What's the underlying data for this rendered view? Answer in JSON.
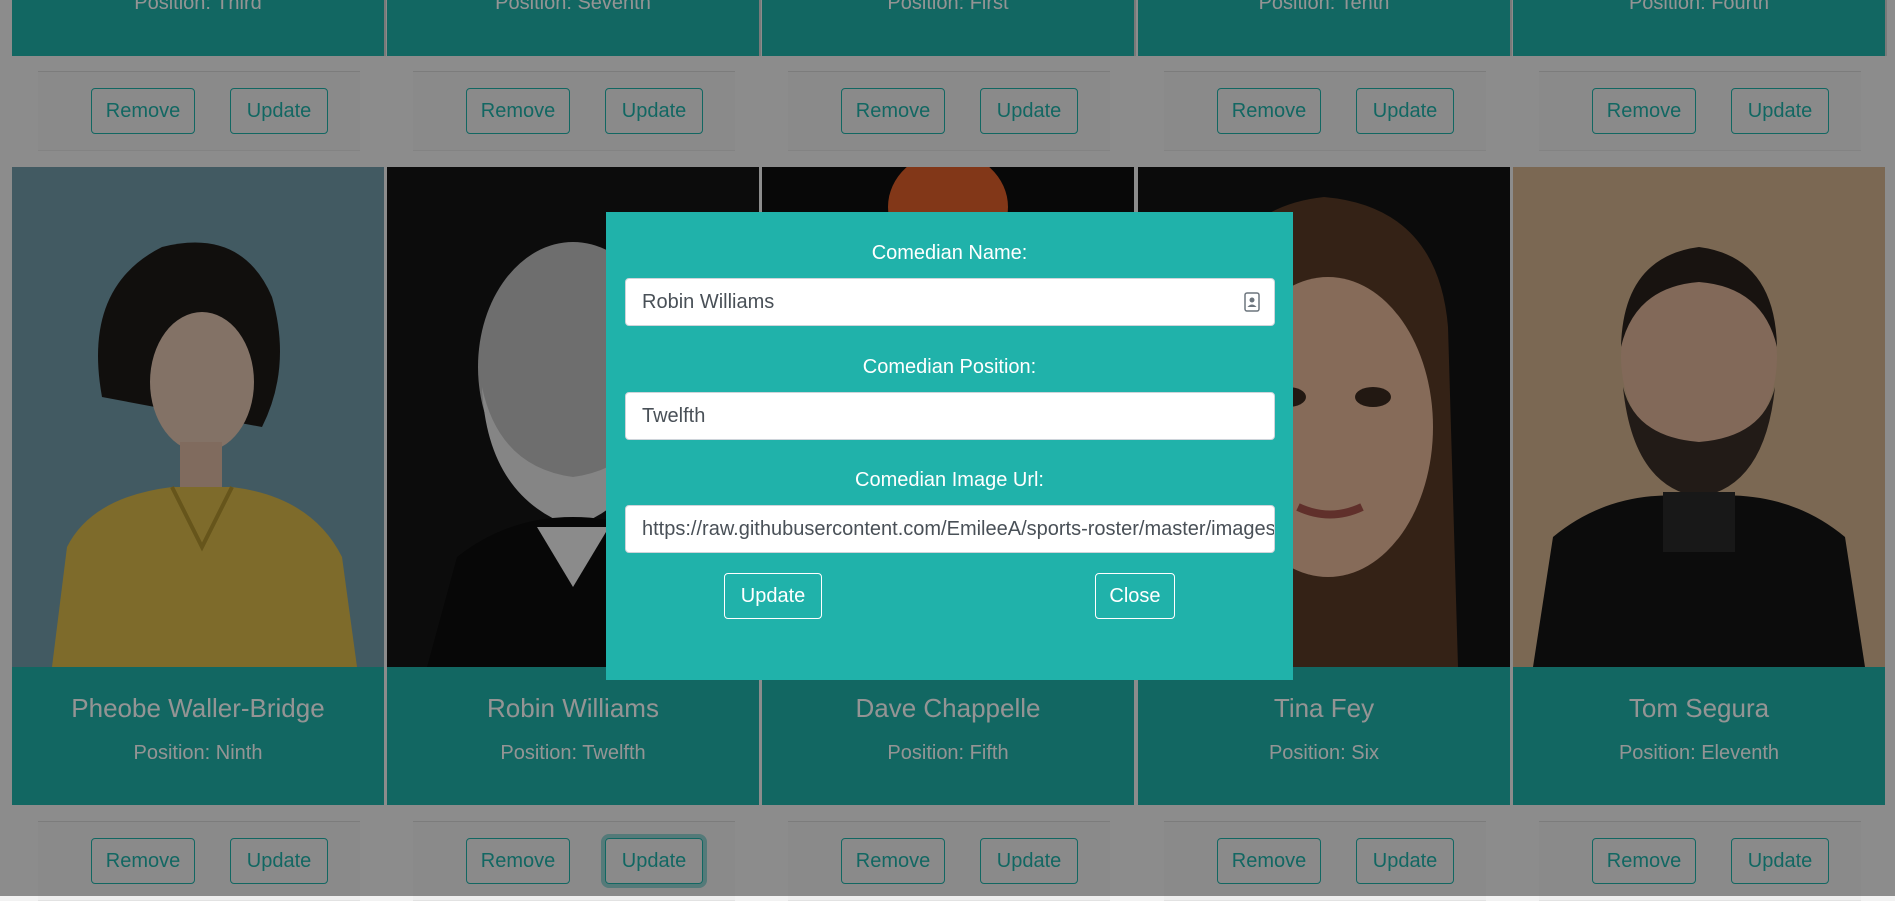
{
  "top_row": [
    {
      "position": "Position: Third",
      "remove_label": "Remove",
      "update_label": "Update"
    },
    {
      "position": "Position: Seventh",
      "remove_label": "Remove",
      "update_label": "Update"
    },
    {
      "position": "Position: First",
      "remove_label": "Remove",
      "update_label": "Update"
    },
    {
      "position": "Position: Tenth",
      "remove_label": "Remove",
      "update_label": "Update"
    },
    {
      "position": "Position: Fourth",
      "remove_label": "Remove",
      "update_label": "Update"
    }
  ],
  "bottom_row": [
    {
      "name": "Pheobe Waller-Bridge",
      "position": "Position: Ninth",
      "remove_label": "Remove",
      "update_label": "Update"
    },
    {
      "name": "Robin Williams",
      "position": "Position: Twelfth",
      "remove_label": "Remove",
      "update_label": "Update"
    },
    {
      "name": "Dave Chappelle",
      "position": "Position: Fifth",
      "remove_label": "Remove",
      "update_label": "Update"
    },
    {
      "name": "Tina Fey",
      "position": "Position: Six",
      "remove_label": "Remove",
      "update_label": "Update"
    },
    {
      "name": "Tom Segura",
      "position": "Position: Eleventh",
      "remove_label": "Remove",
      "update_label": "Update"
    }
  ],
  "modal": {
    "name_label": "Comedian Name:",
    "name_value": "Robin Williams",
    "position_label": "Comedian Position:",
    "position_value": "Twelfth",
    "image_label": "Comedian Image Url:",
    "image_value": "https://raw.githubusercontent.com/EmileeA/sports-roster/master/images/robin.jpg",
    "update_label": "Update",
    "close_label": "Close"
  },
  "colors": {
    "accent": "#20b2aa",
    "overlay": "rgba(0,0,0,0.42)"
  }
}
